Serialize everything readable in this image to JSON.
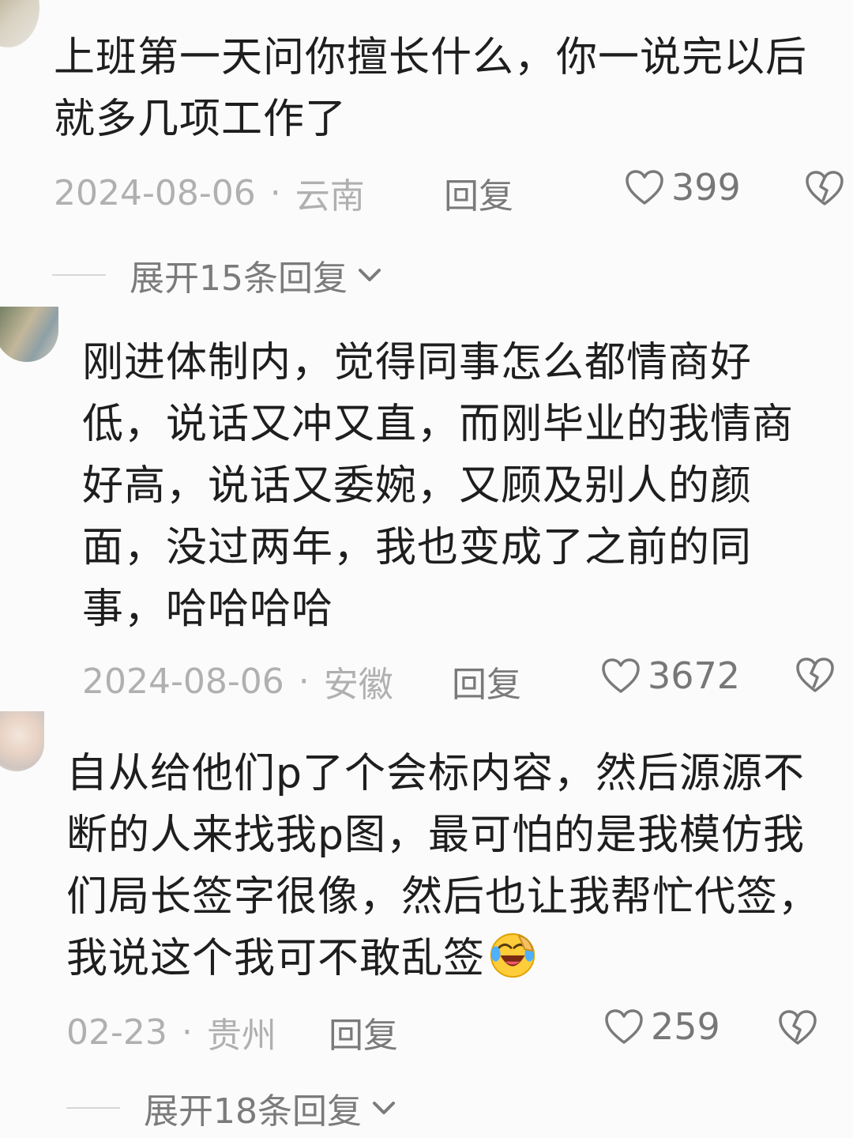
{
  "comments": [
    {
      "username": "",
      "text": "上班第一天问你擅长什么，你一说完以后就多几项工作了",
      "date": "2024-08-06",
      "separator": "·",
      "location": "云南",
      "reply_label": "回复",
      "likes": "399",
      "expand_label": "展开15条回复"
    },
    {
      "username": "",
      "text": "刚进体制内，觉得同事怎么都情商好低，说话又冲又直，而刚毕业的我情商好高，说话又委婉，又顾及别人的颜面，没过两年，我也变成了之前的同事，哈哈哈哈",
      "date": "2024-08-06",
      "separator": "·",
      "location": "安徽",
      "reply_label": "回复",
      "likes": "3672"
    },
    {
      "username": "",
      "text": "自从给他们p了个会标内容，然后源源不断的人来找我p图，最可怕的是我模仿我们局长签字很像，然后也让我帮忙代签，我说这个我可不敢乱签",
      "date": "02-23",
      "separator": "·",
      "location": "贵州",
      "reply_label": "回复",
      "likes": "259",
      "expand_label": "展开18条回复"
    }
  ],
  "icons": {
    "like": "heart-outline-icon",
    "dislike": "broken-heart-icon",
    "chevron": "chevron-down-icon",
    "emoji": "laughing-crying-emoji"
  },
  "colors": {
    "background": "#fbfbfb",
    "text": "#1e1e1e",
    "muted": "#b0b0b0",
    "action": "#7a7a7a"
  }
}
